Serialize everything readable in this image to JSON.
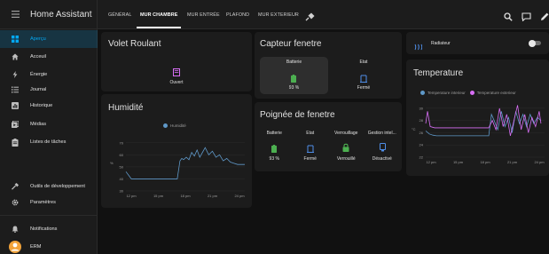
{
  "app": {
    "title": "Home Assistant"
  },
  "sidebar": {
    "items": [
      {
        "label": "Aperçu",
        "icon": "grid-icon"
      },
      {
        "label": "Acceuil",
        "icon": "home-icon"
      },
      {
        "label": "Énergie",
        "icon": "lightning-icon"
      },
      {
        "label": "Journal",
        "icon": "list-icon"
      },
      {
        "label": "Historique",
        "icon": "chart-box-icon"
      },
      {
        "label": "Médias",
        "icon": "media-icon"
      },
      {
        "label": "Listes de tâches",
        "icon": "clipboard-icon"
      }
    ],
    "bottom_items": [
      {
        "label": "Outils de développement",
        "icon": "hammer-icon"
      },
      {
        "label": "Paramètres",
        "icon": "cog-icon"
      },
      {
        "label": "Notifications",
        "icon": "bell-icon"
      },
      {
        "label": "ERM",
        "icon": "avatar"
      }
    ],
    "accent": "#03a9f4"
  },
  "tabs": [
    "GÉNÉRAL",
    "MUR CHAMBRE",
    "MUR ENTRÉE",
    "PLAFOND",
    "MUR EXTERIEUR"
  ],
  "active_tab": "MUR CHAMBRE",
  "volet": {
    "title": "Volet Roulant",
    "state": "Ouvert"
  },
  "humidite": {
    "title": "Humidité",
    "legend": "Humidité",
    "unit": "%",
    "y_ticks": [
      "70",
      "60",
      "50",
      "40",
      "30"
    ],
    "x_ticks": [
      "12 pm",
      "15 pm",
      "18 pm",
      "21 pm",
      "24 pm"
    ]
  },
  "capteur": {
    "title": "Capteur fenetre",
    "col1": {
      "label": "Batterie",
      "value": "93 %"
    },
    "col2": {
      "label": "Etat",
      "value": "Fermé"
    }
  },
  "poignee": {
    "title": "Poignée de fenetre",
    "cols": [
      {
        "label": "Batterie",
        "value": "93 %"
      },
      {
        "label": "Etat",
        "value": "Fermé"
      },
      {
        "label": "Verrouillage",
        "value": "Verrouillé"
      },
      {
        "label": "Gestion intel...",
        "value": "Désactivé"
      }
    ]
  },
  "radiateur": {
    "label": "Radiateur"
  },
  "temperature": {
    "title": "Temperature",
    "legend1": "Temperature interieur",
    "legend2": "Temperature exterieur",
    "unit": "°C",
    "y_ticks": [
      "30",
      "28",
      "26",
      "24",
      "22"
    ],
    "x_ticks": [
      "12 pm",
      "15 pm",
      "18 pm",
      "21 pm",
      "24 pm"
    ]
  },
  "colors": {
    "background": "#111111",
    "card": "#1c1c1c",
    "green": "#4caf50",
    "blue_icon": "#4f8ee8",
    "purple": "#d76ef5",
    "chart_blue": "#5f98c8"
  },
  "chart_data": [
    {
      "type": "line",
      "title": "Humidité",
      "ylabel": "%",
      "ylim": [
        30,
        75
      ],
      "x_ticks": [
        "12 pm",
        "15 pm",
        "18 pm",
        "21 pm",
        "24 pm"
      ],
      "series": [
        {
          "name": "Humidité",
          "x": [
            0,
            0.3,
            0.6,
            1.5,
            2.6,
            3.0,
            3.2,
            3.8,
            4.4,
            5.0,
            5.4,
            5.7,
            6.0,
            6.2,
            6.4,
            6.7,
            7.0,
            7.3,
            7.6,
            7.9,
            8.2,
            8.5,
            8.8,
            9.2,
            9.6,
            10.0,
            10.4,
            10.8,
            11.2,
            11.6,
            12.0,
            12.4,
            12.8,
            13.2
          ],
          "values": [
            46,
            43,
            40,
            40,
            40,
            40,
            40,
            40,
            40,
            40,
            40,
            40,
            55,
            57,
            56,
            58,
            56,
            62,
            59,
            64,
            58,
            62,
            66,
            60,
            63,
            58,
            60,
            55,
            57,
            54,
            53,
            52,
            52,
            52
          ]
        }
      ]
    },
    {
      "type": "line",
      "title": "Temperature",
      "ylabel": "°C",
      "ylim": [
        22,
        31
      ],
      "x_ticks": [
        "12 pm",
        "15 pm",
        "18 pm",
        "21 pm",
        "24 pm"
      ],
      "series": [
        {
          "name": "Temperature interieur",
          "x": [
            0,
            0.4,
            0.8,
            1.2,
            4.0,
            7.0,
            7.3,
            7.6,
            8.0,
            8.4,
            8.8,
            9.2,
            9.6,
            10.0,
            10.4,
            10.8,
            11.2,
            11.6,
            12.0,
            12.4,
            12.8
          ],
          "values": [
            26.3,
            25.8,
            25.6,
            25.5,
            25.5,
            25.5,
            29,
            28,
            26.5,
            29.5,
            27,
            28.5,
            26,
            29.5,
            27.5,
            29,
            27,
            29,
            27.5,
            28.5,
            28
          ]
        },
        {
          "name": "Temperature exterieur",
          "x": [
            0,
            0.2,
            0.5,
            1.0,
            4.0,
            7.0,
            7.4,
            7.8,
            8.2,
            8.6,
            9.0,
            9.4,
            9.8,
            10.2,
            10.6,
            11.0,
            11.4,
            11.8,
            12.2,
            12.6,
            12.8
          ],
          "values": [
            27.5,
            29.5,
            27,
            26.8,
            26.8,
            26.8,
            28,
            26.5,
            30,
            27,
            29,
            25.5,
            28,
            30.5,
            26.5,
            29,
            26,
            28.5,
            27,
            29.5,
            27.5
          ]
        }
      ]
    }
  ]
}
